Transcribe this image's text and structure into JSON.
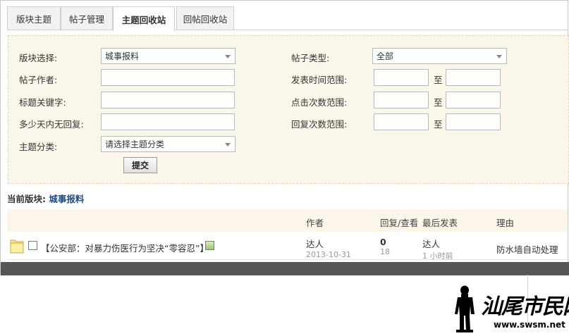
{
  "tabs": [
    {
      "label": "版块主题"
    },
    {
      "label": "帖子管理"
    },
    {
      "label": "主题回收站"
    },
    {
      "label": "回帖回收站"
    }
  ],
  "form": {
    "board_label": "版块选择:",
    "board_value": "城事报料",
    "type_label": "帖子类型:",
    "type_value": "全部",
    "author_label": "帖子作者:",
    "author_value": "",
    "date_label": "发表时间范围:",
    "keyword_label": "标题关键字:",
    "keyword_value": "",
    "clicks_label": "点击次数范围:",
    "noreply_label": "多少天内无回复:",
    "noreply_value": "",
    "replies_label": "回复次数范围:",
    "category_label": "主题分类:",
    "category_value": "请选择主题分类",
    "range_sep": "至",
    "submit_label": "提交"
  },
  "current_board": {
    "label": "当前版块:",
    "value": "城事报料"
  },
  "table": {
    "headers": {
      "author": "作者",
      "replies_views": "回复/查看",
      "last_post": "最后发表",
      "reason": "理由"
    },
    "rows": [
      {
        "title": "【公安部：对暴力伤医行为坚决“零容忍”】",
        "author": "达人",
        "date": "2013-10-31",
        "replies": "0",
        "views": "18",
        "last_author": "达人",
        "last_time": "1 小时前",
        "reason": "防水墙自动处理"
      }
    ]
  },
  "watermark": {
    "text": "汕尾市民网",
    "url": "www.swsm.net"
  }
}
